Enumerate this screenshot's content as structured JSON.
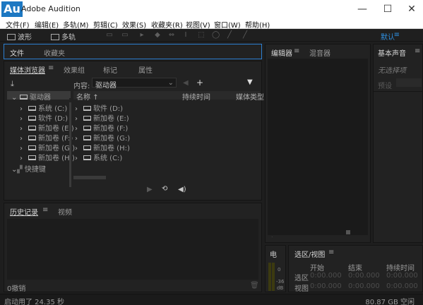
{
  "window": {
    "logo": "Au",
    "title": "Adobe Audition",
    "minimize": "—",
    "maximize": "☐",
    "close": "✕"
  },
  "menu": [
    "文件(F)",
    "编辑(E)",
    "多轨(M)",
    "剪辑(C)",
    "效果(S)",
    "收藏夹(R)",
    "视图(V)",
    "窗口(W)",
    "帮助(H)"
  ],
  "toolbar": {
    "waveform": "波形",
    "multitrack": "多轨",
    "workspace": "默认",
    "workspace_menu": "≡"
  },
  "files_panel": {
    "tabs": [
      "文件",
      "收藏夹"
    ]
  },
  "media_browser": {
    "tabs": [
      "媒体浏览器",
      "效果组",
      "标记",
      "属性"
    ],
    "tab_menu": "≡",
    "content_label": "内容:",
    "content_value": "驱动器",
    "col_name": "名称",
    "col_duration": "持续时间",
    "col_media_type": "媒体类型",
    "left_root": "驱动器",
    "left_items": [
      "系统 (C:)",
      "软件 (D:)",
      "新加卷 (E:)",
      "新加卷 (F:)",
      "新加卷 (G:)",
      "新加卷 (H:)"
    ],
    "shortcuts": "快捷键",
    "right_items": [
      "软件 (D:)",
      "新加卷 (E:)",
      "新加卷 (F:)",
      "新加卷 (G:)",
      "新加卷 (H:)",
      "系统 (C:)"
    ]
  },
  "history_panel": {
    "tabs": [
      "历史记录",
      "视频"
    ],
    "tab_menu": "≡",
    "undo_count": "0撤销"
  },
  "editor_panel": {
    "tabs": [
      "编辑器",
      "混音器"
    ],
    "tab_menu": "≡"
  },
  "essential_sound": {
    "title": "基本声音",
    "tab_menu": "≡",
    "no_selection": "无选择项",
    "preset_label": "预设"
  },
  "meter_panel": {
    "title": "电",
    "ticks": [
      "0",
      "-36",
      "dB"
    ]
  },
  "selection_panel": {
    "title": "选区/视图",
    "tab_menu": "≡",
    "cols": [
      "开始",
      "结束",
      "持续时间"
    ],
    "rows": [
      {
        "label": "选区",
        "start": "0:00.000",
        "end": "0:00.000",
        "dur": "0:00.000"
      },
      {
        "label": "视图",
        "start": "0:00.000",
        "end": "0:00.000",
        "dur": "0:00.000"
      }
    ]
  },
  "status": {
    "startup": "启动用了 24.35 秒",
    "disk": "80.87 GB 空闲"
  }
}
